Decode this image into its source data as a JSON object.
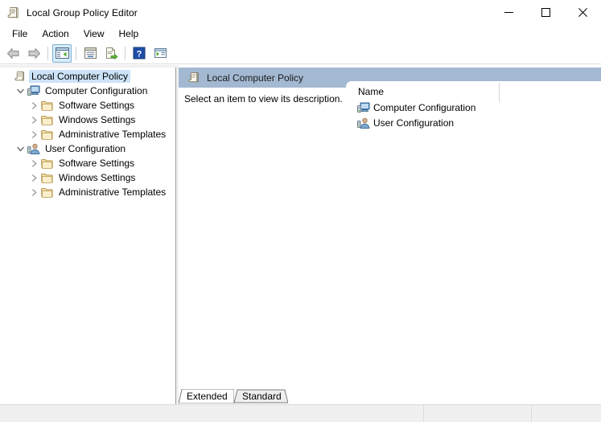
{
  "window": {
    "title": "Local Group Policy Editor",
    "title_icon": "policy-scroll-icon",
    "controls": [
      {
        "name": "minimize",
        "glyph": "minimize-icon"
      },
      {
        "name": "maximize",
        "glyph": "maximize-icon"
      },
      {
        "name": "close",
        "glyph": "close-icon"
      }
    ]
  },
  "menubar": {
    "items": [
      {
        "label": "File"
      },
      {
        "label": "Action"
      },
      {
        "label": "View"
      },
      {
        "label": "Help"
      }
    ]
  },
  "toolbar": {
    "buttons": [
      {
        "name": "back-button",
        "icon": "back-arrow-icon",
        "active": false
      },
      {
        "name": "forward-button",
        "icon": "forward-arrow-icon",
        "active": false
      },
      {
        "name": "separator-1",
        "icon": "separator",
        "active": false
      },
      {
        "name": "show-hide-tree-button",
        "icon": "show-tree-icon",
        "active": true
      },
      {
        "name": "separator-2",
        "icon": "separator",
        "active": false
      },
      {
        "name": "properties-button",
        "icon": "properties-icon",
        "active": false
      },
      {
        "name": "export-list-button",
        "icon": "export-list-icon",
        "active": false
      },
      {
        "name": "separator-3",
        "icon": "separator",
        "active": false
      },
      {
        "name": "help-button",
        "icon": "help-icon",
        "active": false
      },
      {
        "name": "show-console-tree-button",
        "icon": "console-window-icon",
        "active": false
      }
    ]
  },
  "tree": {
    "nodes": [
      {
        "label": "Local Computer Policy",
        "indent": 0,
        "twisty": "none",
        "icon": "policy-scroll-icon",
        "selected": true
      },
      {
        "label": "Computer Configuration",
        "indent": 1,
        "twisty": "expanded",
        "icon": "computer-icon",
        "selected": false
      },
      {
        "label": "Software Settings",
        "indent": 2,
        "twisty": "collapsed",
        "icon": "folder-icon",
        "selected": false
      },
      {
        "label": "Windows Settings",
        "indent": 2,
        "twisty": "collapsed",
        "icon": "folder-icon",
        "selected": false
      },
      {
        "label": "Administrative Templates",
        "indent": 2,
        "twisty": "collapsed",
        "icon": "folder-icon",
        "selected": false
      },
      {
        "label": "User Configuration",
        "indent": 1,
        "twisty": "expanded",
        "icon": "user-icon",
        "selected": false
      },
      {
        "label": "Software Settings",
        "indent": 2,
        "twisty": "collapsed",
        "icon": "folder-icon",
        "selected": false
      },
      {
        "label": "Windows Settings",
        "indent": 2,
        "twisty": "collapsed",
        "icon": "folder-icon",
        "selected": false
      },
      {
        "label": "Administrative Templates",
        "indent": 2,
        "twisty": "collapsed",
        "icon": "folder-icon",
        "selected": false
      }
    ]
  },
  "right_pane": {
    "header_title": "Local Computer Policy",
    "header_icon": "policy-scroll-icon",
    "header_color": "#a3b8d1",
    "description": "Select an item to view its description.",
    "columns": [
      {
        "label": "Name"
      }
    ],
    "rows": [
      {
        "name": "Computer Configuration",
        "icon": "computer-icon"
      },
      {
        "name": "User Configuration",
        "icon": "user-icon"
      }
    ]
  },
  "tabs": {
    "items": [
      {
        "label": "Extended",
        "selected": true
      },
      {
        "label": "Standard",
        "selected": false
      }
    ]
  },
  "statusbar": {
    "cells": [
      {
        "text": ""
      },
      {
        "text": ""
      },
      {
        "text": ""
      }
    ]
  },
  "colors": {
    "selection": "#cce3f7",
    "header_blue": "#a3b8d1",
    "window_bg": "#ffffff",
    "chrome_bg": "#f0f0f0"
  }
}
